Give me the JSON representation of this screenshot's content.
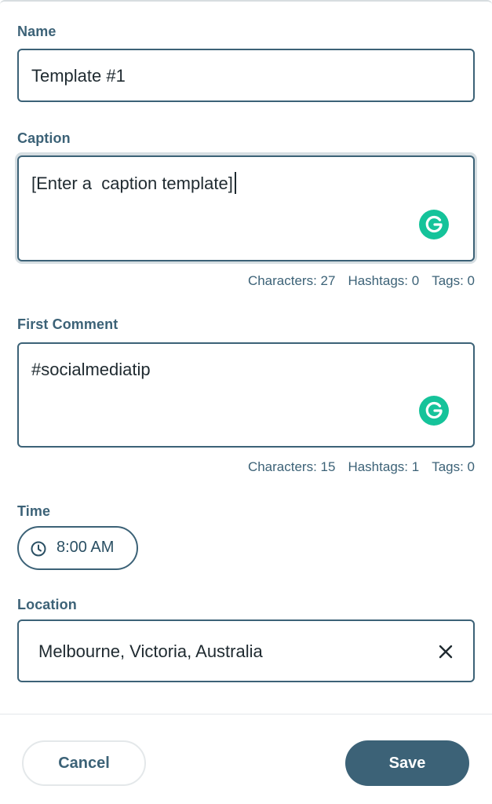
{
  "form": {
    "name": {
      "label": "Name",
      "value": "Template #1"
    },
    "caption": {
      "label": "Caption",
      "value": "[Enter a  caption template]",
      "counters": {
        "characters": "Characters: 27",
        "hashtags": "Hashtags: 0",
        "tags": "Tags: 0"
      }
    },
    "first_comment": {
      "label": "First Comment",
      "value": "#socialmediatip",
      "counters": {
        "characters": "Characters: 15",
        "hashtags": "Hashtags: 1",
        "tags": "Tags: 0"
      }
    },
    "time": {
      "label": "Time",
      "value": "8:00 AM",
      "icon": "clock-icon"
    },
    "location": {
      "label": "Location",
      "value": "Melbourne, Victoria, Australia",
      "clear_icon": "close-icon"
    }
  },
  "footer": {
    "cancel_label": "Cancel",
    "save_label": "Save"
  },
  "colors": {
    "accent": "#3c6277",
    "grammarly": "#15c39a",
    "text": "#1f2a30"
  }
}
